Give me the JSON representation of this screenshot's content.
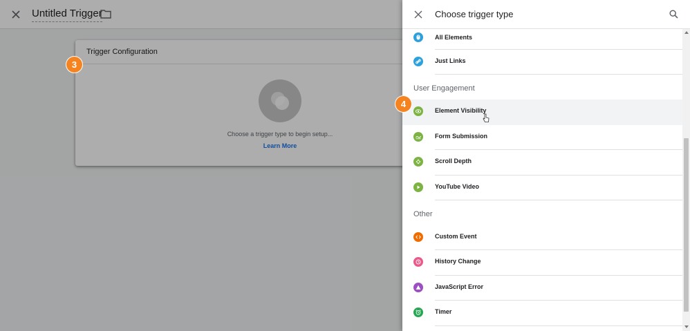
{
  "editor": {
    "title": "Untitled Trigger",
    "card_title": "Trigger Configuration",
    "hint": "Choose a trigger type to begin setup...",
    "learn_more": "Learn More"
  },
  "steps": {
    "badge_a": "3",
    "badge_b": "4"
  },
  "panel": {
    "title": "Choose trigger type",
    "top_items": [
      {
        "label": "All Elements",
        "icon": "cursor-click-icon",
        "color": "#2ea0db"
      },
      {
        "label": "Just Links",
        "icon": "link-icon",
        "color": "#2ea0db"
      }
    ],
    "sections": [
      {
        "label": "User Engagement",
        "items": [
          {
            "label": "Element Visibility",
            "icon": "eye-icon",
            "color": "#7cb342"
          },
          {
            "label": "Form Submission",
            "icon": "form-icon",
            "color": "#7cb342"
          },
          {
            "label": "Scroll Depth",
            "icon": "scroll-arrows-icon",
            "color": "#7cb342"
          },
          {
            "label": "YouTube Video",
            "icon": "play-icon",
            "color": "#7cb342"
          }
        ]
      },
      {
        "label": "Other",
        "items": [
          {
            "label": "Custom Event",
            "icon": "code-icon",
            "color": "#ef6c00"
          },
          {
            "label": "History Change",
            "icon": "history-icon",
            "color": "#e95a8a"
          },
          {
            "label": "JavaScript Error",
            "icon": "warning-icon",
            "color": "#9c4fc2"
          },
          {
            "label": "Timer",
            "icon": "alarm-clock-icon",
            "color": "#26a653"
          }
        ]
      }
    ]
  }
}
